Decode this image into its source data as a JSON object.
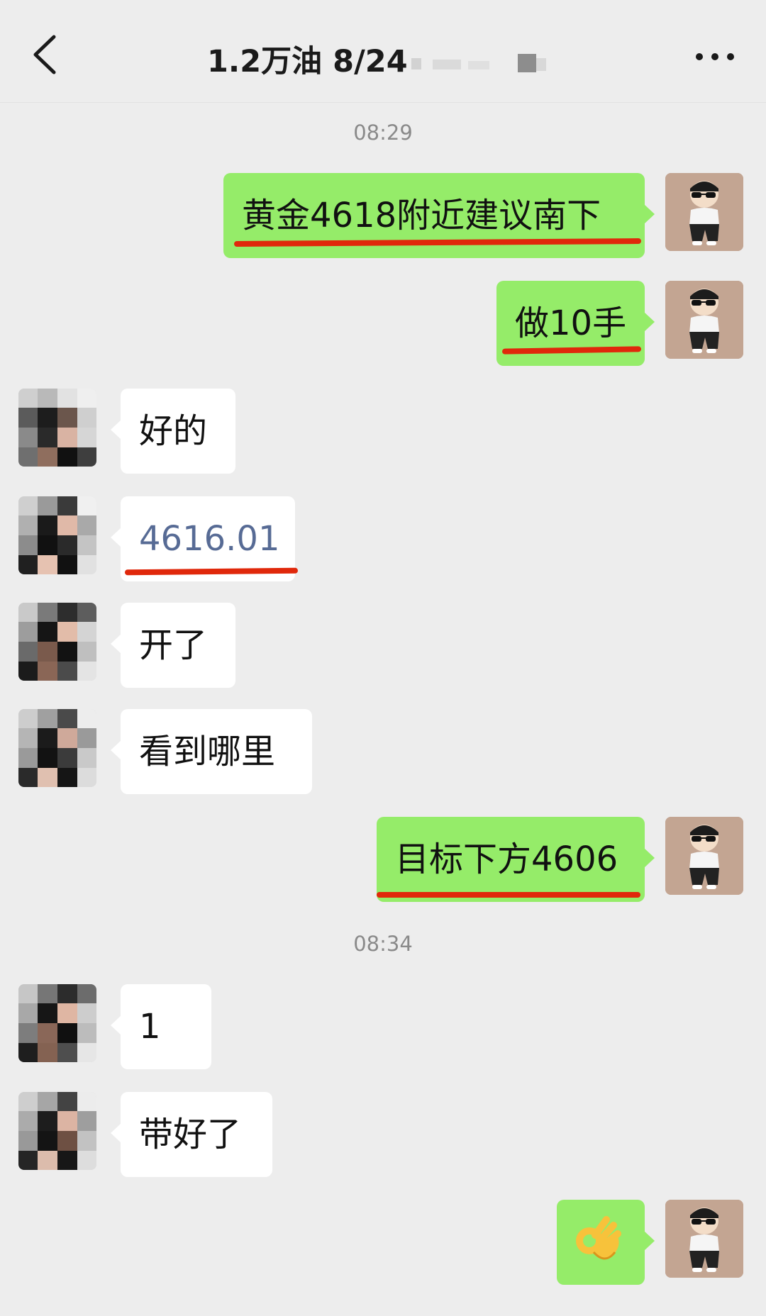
{
  "header": {
    "title": "1.2万油  8/24"
  },
  "timestamps": [
    "08:29",
    "08:34"
  ],
  "messages": [
    {
      "side": "me",
      "text": "黄金4618附近建议南下",
      "underlined": true
    },
    {
      "side": "me",
      "text": "做10手",
      "underlined": true
    },
    {
      "side": "them",
      "text": "好的"
    },
    {
      "side": "them",
      "text": "4616.01",
      "link": true,
      "underlined": true
    },
    {
      "side": "them",
      "text": "开了"
    },
    {
      "side": "them",
      "text": "看到哪里"
    },
    {
      "side": "me",
      "text": "目标下方4606",
      "underlined": true
    },
    {
      "side": "them",
      "text": "1"
    },
    {
      "side": "them",
      "text": "带好了"
    },
    {
      "side": "me",
      "emoji": "ok-hand-emoji"
    }
  ],
  "colors": {
    "background": "#ededed",
    "my_bubble": "#95ec69",
    "their_bubble": "#ffffff",
    "link": "#576b95",
    "annotation_underline": "#e0280b"
  }
}
